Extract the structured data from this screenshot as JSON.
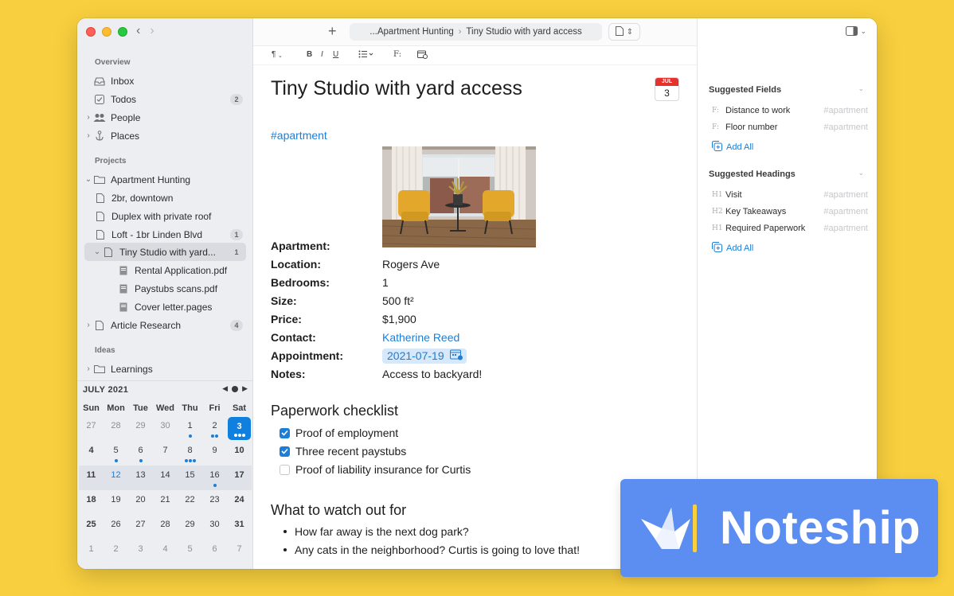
{
  "sidebar": {
    "overview_label": "Overview",
    "projects_label": "Projects",
    "ideas_label": "Ideas",
    "overview": [
      {
        "label": "Inbox",
        "icon": "inbox-icon"
      },
      {
        "label": "Todos",
        "icon": "checkbox-icon",
        "badge": "2"
      },
      {
        "label": "People",
        "icon": "people-icon"
      },
      {
        "label": "Places",
        "icon": "anchor-icon"
      }
    ],
    "projects": [
      {
        "label": "Apartment Hunting"
      },
      {
        "label": "2br, downtown"
      },
      {
        "label": "Duplex with private roof"
      },
      {
        "label": "Loft - 1br Linden Blvd",
        "badge": "1"
      },
      {
        "label": "Tiny Studio with yard...",
        "badge": "1"
      },
      {
        "label": "Rental Application.pdf"
      },
      {
        "label": "Paystubs scans.pdf"
      },
      {
        "label": "Cover letter.pages"
      },
      {
        "label": "Article Research",
        "badge": "4"
      }
    ],
    "ideas": [
      {
        "label": "Learnings"
      }
    ]
  },
  "calendar": {
    "month": "JULY 2021",
    "weekdays": [
      "Sun",
      "Mon",
      "Tue",
      "Wed",
      "Thu",
      "Fri",
      "Sat"
    ],
    "weeks": [
      [
        "27",
        "28",
        "29",
        "30",
        "1",
        "2",
        "3"
      ],
      [
        "4",
        "5",
        "6",
        "7",
        "8",
        "9",
        "10"
      ],
      [
        "11",
        "12",
        "13",
        "14",
        "15",
        "16",
        "17"
      ],
      [
        "18",
        "19",
        "20",
        "21",
        "22",
        "23",
        "24"
      ],
      [
        "25",
        "26",
        "27",
        "28",
        "29",
        "30",
        "31"
      ],
      [
        "1",
        "2",
        "3",
        "4",
        "5",
        "6",
        "7"
      ]
    ],
    "today": "3",
    "accent": "#0f7fe0"
  },
  "toolbar": {
    "new_icon": "+",
    "breadcrumb_parent": "...Apartment Hunting",
    "breadcrumb_current": "Tiny Studio with yard access",
    "format_items": [
      "¶",
      "B",
      "I",
      "U",
      "F:"
    ]
  },
  "doc": {
    "title": "Tiny Studio with yard access",
    "date_badge_month": "JUL",
    "date_badge_day": "3",
    "tag": "#apartment",
    "props": [
      {
        "key": "Apartment:",
        "value": ""
      },
      {
        "key": "Location:",
        "value": "Rogers Ave"
      },
      {
        "key": "Bedrooms:",
        "value": "1"
      },
      {
        "key": "Size:",
        "value": "500 ft²"
      },
      {
        "key": "Price:",
        "value": "$1,900"
      },
      {
        "key": "Contact:",
        "value": "Katherine Reed"
      },
      {
        "key": "Appointment:",
        "value": "2021-07-19"
      },
      {
        "key": "Notes:",
        "value": "Access to backyard!"
      }
    ],
    "checklist_heading": "Paperwork checklist",
    "checklist": [
      {
        "label": "Proof of employment",
        "checked": true
      },
      {
        "label": "Three recent paystubs",
        "checked": true
      },
      {
        "label": "Proof of liability insurance for Curtis",
        "checked": false
      }
    ],
    "watch_heading": "What to watch out for",
    "bullets": [
      "How far away is the next dog park?",
      "Any cats in the neighborhood? Curtis is going to love that!"
    ]
  },
  "rightpanel": {
    "fields_heading": "Suggested Fields",
    "fields": [
      {
        "prefix": "F:",
        "label": "Distance to work",
        "hint": "#apartment"
      },
      {
        "prefix": "F:",
        "label": "Floor number",
        "hint": "#apartment"
      }
    ],
    "add_all": "Add All",
    "headings_heading": "Suggested Headings",
    "headings": [
      {
        "prefix": "H1",
        "label": "Visit",
        "hint": "#apartment"
      },
      {
        "prefix": "H2",
        "label": "Key Takeaways",
        "hint": "#apartment"
      },
      {
        "prefix": "H1",
        "label": "Required Paperwork",
        "hint": "#apartment"
      }
    ]
  },
  "banner": {
    "brand": "Noteship",
    "brand_color": "#5b8ef0",
    "background_color": "#f8cf3e"
  }
}
